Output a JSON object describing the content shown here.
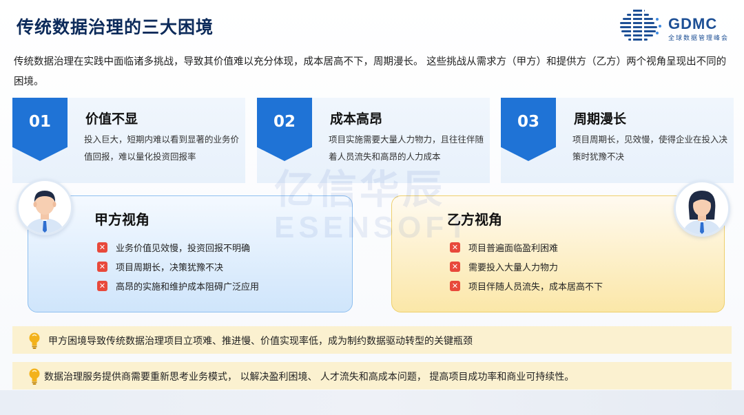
{
  "title": "传统数据治理的三大困境",
  "logo": {
    "name": "GDMC",
    "subtitle": "全球数据管理峰会"
  },
  "intro": "传统数据治理在实践中面临诸多挑战，导致其价值难以充分体现，成本居高不下，周期漫长。 这些挑战从需求方（甲方）和提供方（乙方）两个视角呈现出不同的困境。",
  "cards": [
    {
      "number": "01",
      "title": "价值不显",
      "desc": "投入巨大，短期内难以看到显著的业务价值回报，难以量化投资回报率"
    },
    {
      "number": "02",
      "title": "成本高昂",
      "desc": "项目实施需要大量人力物力，且往往伴随着人员流失和高昂的人力成本"
    },
    {
      "number": "03",
      "title": "周期漫长",
      "desc": "项目周期长，见效慢，使得企业在投入决策时犹豫不决"
    }
  ],
  "watermark": {
    "line1": "亿信华辰",
    "line2": "ESENSOFT"
  },
  "panel_a": {
    "title": "甲方视角",
    "items": [
      "业务价值见效慢，投资回报不明确",
      "项目周期长，决策犹豫不决",
      "高昂的实施和维护成本阻碍广泛应用"
    ]
  },
  "panel_b": {
    "title": "乙方视角",
    "items": [
      "项目普遍面临盈利困难",
      "需要投入大量人力物力",
      "项目伴随人员流失，成本居高不下"
    ]
  },
  "tips": [
    "甲方困境导致传统数据治理项目立项难、推进慢、价值实现率低，成为制约数据驱动转型的关键瓶颈",
    "数据治理服务提供商需要重新思考业务模式， 以解决盈利困境、 人才流失和高成本问题， 提高项目成功率和商业可持续性。"
  ],
  "icons": {
    "flag": "number-flag",
    "x": "x-mark-icon",
    "bulb": "lightbulb-icon",
    "logo": "globe-logo-icon"
  },
  "colors": {
    "accent": "#1f73d6",
    "title": "#0c2a5a",
    "x_mark": "#e8493b",
    "tip_bg": "#fbf1d0",
    "panel_a": "#cfe5fb",
    "panel_b": "#fbe7a8"
  }
}
